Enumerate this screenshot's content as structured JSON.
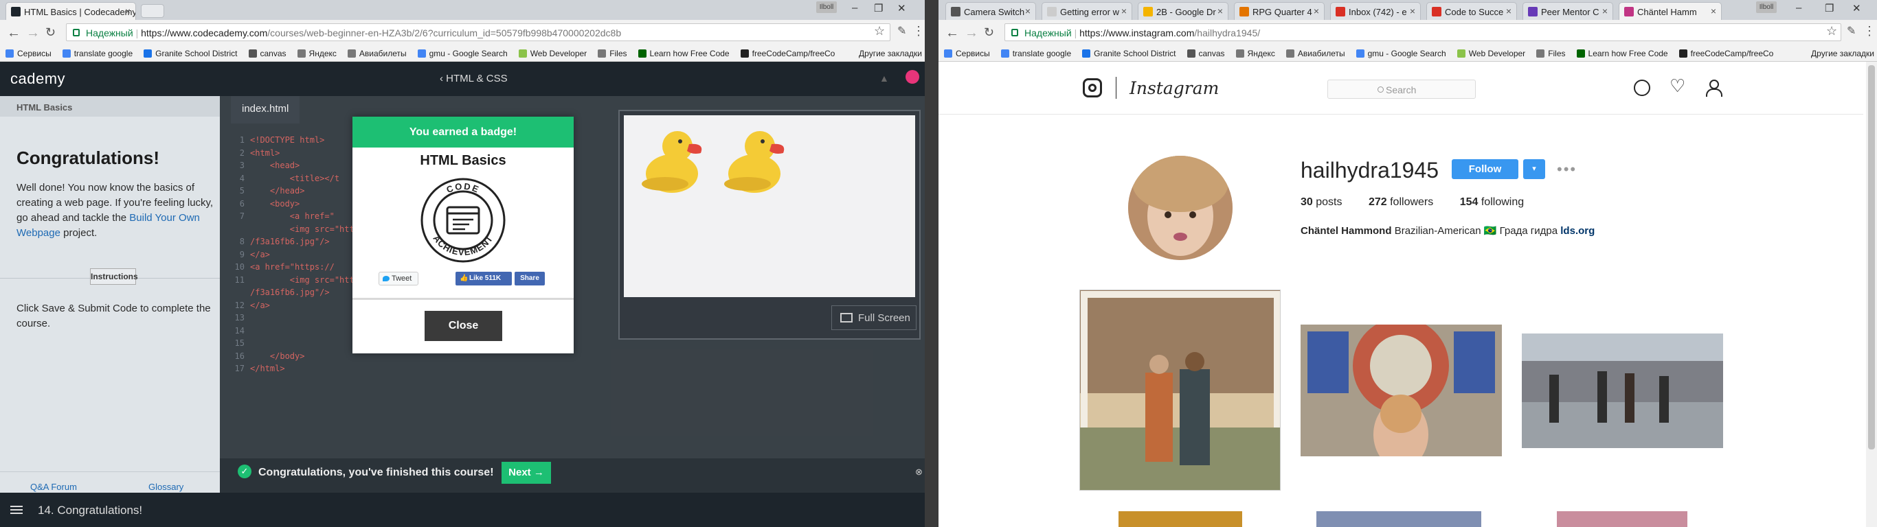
{
  "left_browser": {
    "tabs": [
      {
        "title": "HTML Basics | Codecademy",
        "active": true,
        "favicon_color": "#1d252c"
      }
    ],
    "user_badge": "Ilboll",
    "secure_label": "Надежный",
    "url_host": "https://www.codecademy.com",
    "url_path": "/courses/web-beginner-en-HZA3b/2/6?curriculum_id=50579fb998b470000202dc8b",
    "bookmarks": [
      {
        "label": "Сервисы",
        "color": "#4285f4"
      },
      {
        "label": "translate google",
        "color": "#4285f4"
      },
      {
        "label": "Granite School District",
        "color": "#1a73e8"
      },
      {
        "label": "canvas",
        "color": "#555555"
      },
      {
        "label": "Яндекс",
        "color": "#777777"
      },
      {
        "label": "Авиабилеты",
        "color": "#777777"
      },
      {
        "label": "gmu - Google Search",
        "color": "#4285f4"
      },
      {
        "label": "Web Developer",
        "color": "#8bc34a"
      },
      {
        "label": "Files",
        "color": "#777777"
      },
      {
        "label": "Learn how Free Code",
        "color": "#006400"
      },
      {
        "label": "freeCodeCamp/freeCo",
        "color": "#222222"
      }
    ],
    "other_bookmarks": "Другие закладки"
  },
  "codecademy": {
    "logo_code": "code",
    "logo_rest": "cademy",
    "course_title": "HTML & CSS",
    "lesson_header": "HTML Basics",
    "heading": "Congratulations!",
    "paragraph_before_link": "Well done! You now know the basics of creating a web page. If you're feeling lucky, go ahead and tackle the ",
    "paragraph_link": "Build Your Own Webpage",
    "paragraph_after_link": " project.",
    "instructions_label": "Instructions",
    "instructions_text": "Click Save & Submit Code to complete the course.",
    "footer_links": [
      "Q&A Forum",
      "Glossary"
    ],
    "editor_tab": "index.html",
    "code_lines": [
      "<!DOCTYPE html>",
      "<html>",
      "    <head>",
      "        <title></t",
      "    </head>",
      "    <body>",
      "        <a href=\"",
      "        <img src=\"http                                      ets",
      "/f3a16fb6.jpg\"/>",
      "</a>",
      "<a href=\"https://",
      "        <img src=\"http                                      ets",
      "/f3a16fb6.jpg\"/>",
      "</a>",
      "",
      "",
      "",
      "    </body>",
      "</html>"
    ],
    "code_line_numbers": [
      "1",
      "2",
      "3",
      "4",
      "5",
      "6",
      "7",
      "",
      "8",
      "9",
      "10",
      "11",
      "",
      "12",
      "13",
      "14",
      "15",
      "16",
      "17"
    ],
    "fullscreen_label": "Full Screen",
    "modal": {
      "banner": "You earned a badge!",
      "title": "HTML Basics",
      "badge_top": "CODE",
      "badge_bottom": "ACHIEVEMENT",
      "tweet_label": "Tweet",
      "like_label": "Like 511K",
      "share_label": "Share",
      "close_label": "Close"
    },
    "finish_message": "Congratulations, you've finished this course!",
    "next_label": "Next →",
    "lesson_number": "14. Congratulations!",
    "accent": "#1dbf73",
    "dark": "#1d252c"
  },
  "right_browser": {
    "tabs": [
      {
        "title": "Camera Switch",
        "active": false,
        "favicon_color": "#555555"
      },
      {
        "title": "Getting error w",
        "active": false,
        "favicon_color": "#cccccc"
      },
      {
        "title": "2B - Google Dr",
        "active": false,
        "favicon_color": "#f4b400"
      },
      {
        "title": "RPG Quarter 4",
        "active": false,
        "favicon_color": "#e37400"
      },
      {
        "title": "Inbox (742) - e",
        "active": false,
        "favicon_color": "#d93025"
      },
      {
        "title": "Code to Succe",
        "active": false,
        "favicon_color": "#d93025"
      },
      {
        "title": "Peer Mentor C",
        "active": false,
        "favicon_color": "#673ab7"
      },
      {
        "title": "Chäntel Hamm",
        "active": true,
        "favicon_color": "#c13584"
      }
    ],
    "user_badge": "Ilboll",
    "secure_label": "Надежный",
    "url_host": "https://www.instagram.com",
    "url_path": "/hailhydra1945/",
    "bookmarks": [
      {
        "label": "Сервисы",
        "color": "#4285f4"
      },
      {
        "label": "translate google",
        "color": "#4285f4"
      },
      {
        "label": "Granite School District",
        "color": "#1a73e8"
      },
      {
        "label": "canvas",
        "color": "#555555"
      },
      {
        "label": "Яндекс",
        "color": "#777777"
      },
      {
        "label": "Авиабилеты",
        "color": "#777777"
      },
      {
        "label": "gmu - Google Search",
        "color": "#4285f4"
      },
      {
        "label": "Web Developer",
        "color": "#8bc34a"
      },
      {
        "label": "Files",
        "color": "#777777"
      },
      {
        "label": "Learn how Free Code",
        "color": "#006400"
      },
      {
        "label": "freeCodeCamp/freeCo",
        "color": "#222222"
      }
    ],
    "other_bookmarks": "Другие закладки"
  },
  "instagram": {
    "wordmark": "Instagram",
    "search_placeholder": "Search",
    "username": "hailhydra1945",
    "follow_label": "Follow",
    "dropdown_label": "▾",
    "more_label": "•••",
    "posts_count": "30",
    "posts_label": "posts",
    "followers_count": "272",
    "followers_label": "followers",
    "following_count": "154",
    "following_label": "following",
    "full_name": "Chäntel Hammond",
    "bio": "Brazilian-American 🇧🇷 Града гидра",
    "bio_link": "lds.org",
    "accent": "#3897f0"
  }
}
